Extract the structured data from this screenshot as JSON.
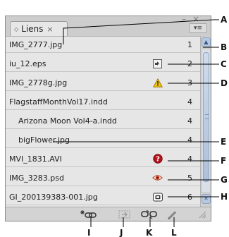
{
  "panel": {
    "tab_label": "Liens",
    "tab_close": "×",
    "minimize_glyph": "–",
    "close_glyph": "×",
    "menu_glyph": "▾≡"
  },
  "rows": [
    {
      "name": "IMG_2777.jpg",
      "page": "1",
      "status_icon": "none"
    },
    {
      "name": "iu_12.eps",
      "page": "2",
      "status_icon": "modified-link-icon"
    },
    {
      "name": "IMG_2778g.jpg",
      "page": "3",
      "status_icon": "warning-icon"
    },
    {
      "name": "FlagstaffMonthVol17.indd",
      "page": "4",
      "status_icon": "none"
    },
    {
      "name": "Arizona Moon Vol4-a.indd",
      "page": "4",
      "status_icon": "none"
    },
    {
      "name": "bigFlower.jpg",
      "page": "4",
      "status_icon": "none"
    },
    {
      "name": "MVI_1831.AVI",
      "page": "4",
      "status_icon": "missing-link-icon"
    },
    {
      "name": "IMG_3283.psd",
      "page": "5",
      "status_icon": "eye-icon"
    },
    {
      "name": "GI_200139383-001.jpg",
      "page": "6",
      "status_icon": "embedded-icon"
    }
  ],
  "toolbar": {
    "icons": [
      "relink-icon",
      "goto-link-icon",
      "update-link-icon",
      "edit-original-icon"
    ]
  },
  "callouts": {
    "A": "A",
    "B": "B",
    "C": "C",
    "D": "D",
    "E": "E",
    "F": "F",
    "G": "G",
    "H": "H",
    "I": "I",
    "J": "J",
    "K": "K",
    "L": "L"
  },
  "colors": {
    "warning": "#f2c200",
    "missing": "#b2121a",
    "eye": "#c0392b",
    "scroll_accent": "#b8c8df"
  }
}
